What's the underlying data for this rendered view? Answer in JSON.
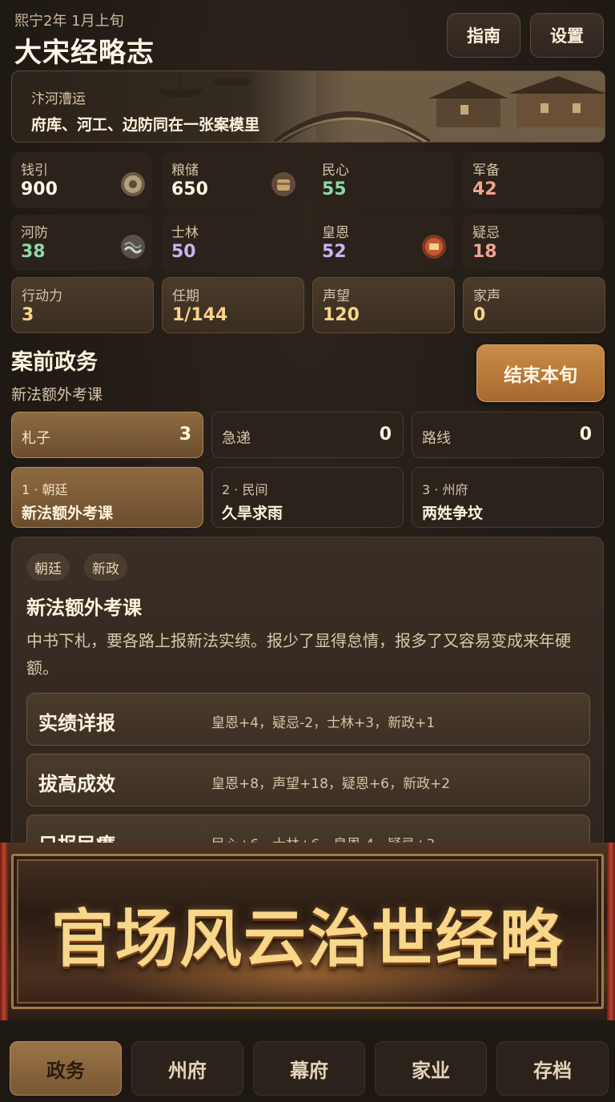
{
  "header": {
    "date": "熙宁2年 1月上旬",
    "title": "大宋经略志",
    "guide_label": "指南",
    "settings_label": "设置"
  },
  "banner": {
    "subtitle": "汴河漕运",
    "caption": "府库、河工、边防同在一张案模里"
  },
  "stats": [
    {
      "label": "钱引",
      "value": "900",
      "icon": "coin-icon"
    },
    {
      "label": "粮储",
      "value": "650",
      "icon": "grain-icon"
    },
    {
      "label": "民心",
      "value": "55"
    },
    {
      "label": "军备",
      "value": "42"
    },
    {
      "label": "河防",
      "value": "38",
      "icon": "levee-icon"
    },
    {
      "label": "士林",
      "value": "50"
    },
    {
      "label": "皇恩",
      "value": "52",
      "icon": "seal-icon"
    },
    {
      "label": "疑忌",
      "value": "18"
    },
    {
      "label": "行动力",
      "value": "3"
    },
    {
      "label": "任期",
      "value": "1/144"
    },
    {
      "label": "声望",
      "value": "120"
    },
    {
      "label": "家声",
      "value": "0"
    }
  ],
  "section": {
    "title": "案前政务",
    "subtitle": "新法额外考课",
    "end_turn_label": "结束本旬"
  },
  "filters": [
    {
      "label": "札子",
      "count": "3"
    },
    {
      "label": "急递",
      "count": "0"
    },
    {
      "label": "路线",
      "count": "0"
    }
  ],
  "cases": [
    {
      "index": "1 · 朝廷",
      "name": "新法额外考课"
    },
    {
      "index": "2 · 民间",
      "name": "久旱求雨"
    },
    {
      "index": "3 · 州府",
      "name": "两姓争坟"
    }
  ],
  "detail": {
    "tags": [
      "朝廷",
      "新政"
    ],
    "title": "新法额外考课",
    "description": "中书下札，要各路上报新法实绩。报少了显得怠情，报多了又容易变成来年硬额。",
    "options": [
      {
        "name": "实绩详报",
        "effects": "皇恩+4，疑忌-2，士林+3，新政+1"
      },
      {
        "name": "拔高成效",
        "effects": "皇恩+8，声望+18，疑恩+6，新政+2"
      },
      {
        "name": "只报民瘼",
        "effects": "民心+6，士林+6，皇恩-4，疑忌+3"
      }
    ]
  },
  "promo": {
    "text": "官场风云治世经略"
  },
  "nav": [
    "政务",
    "州府",
    "幕府",
    "家业",
    "存档"
  ],
  "colors": {
    "accent": "#a76a2e",
    "green_value": "#8ed9a4",
    "red_value": "#f0a38f",
    "purple_value": "#c8b4f0"
  }
}
